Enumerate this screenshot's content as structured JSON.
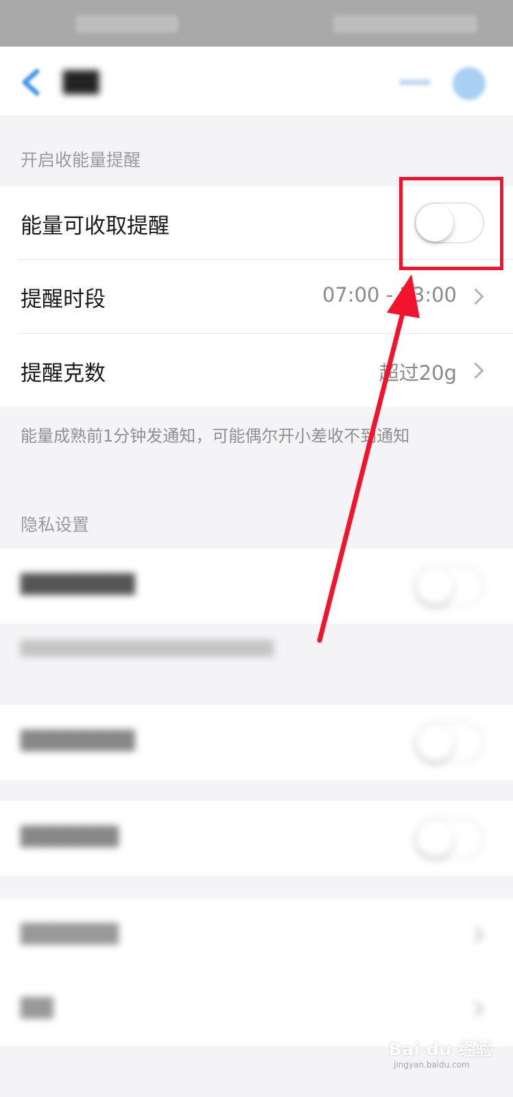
{
  "energy_reminder": {
    "section_title": "开启收能量提醒",
    "collect_reminder_label": "能量可收取提醒",
    "collect_reminder_on": false,
    "time_period_label": "提醒时段",
    "time_period_value": "07:00 - 23:00",
    "grams_label": "提醒克数",
    "grams_value": "超过20g",
    "note": "能量成熟前1分钟发通知，可能偶尔开小差收不到通知"
  },
  "privacy": {
    "section_title": "隐私设置",
    "hide_energy_value_on": false
  },
  "annotation": {
    "highlight_color": "#f2142c"
  },
  "watermark": {
    "text": "Bai du 经验",
    "url": "jingyan.baidu.com"
  }
}
